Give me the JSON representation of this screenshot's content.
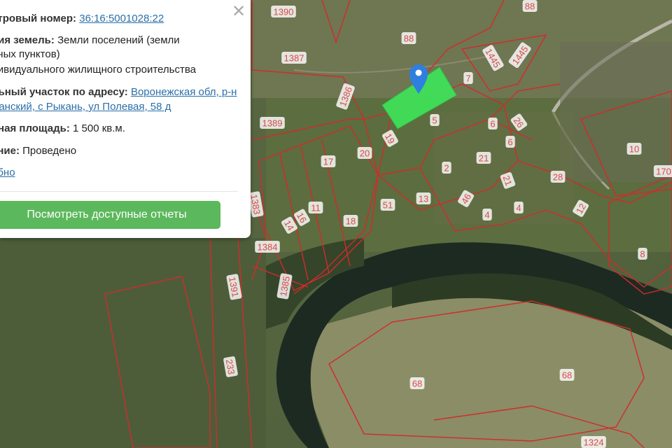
{
  "panel": {
    "cadastral_label": "стровый номер:",
    "cadastral_value": "36:16:5001028:22",
    "category_label": "рия земель:",
    "category_line1": "Земли поселений (земли",
    "category_line2": "нных пунктов)",
    "category_line3": "дивидуального жилищного строительства",
    "address_label": "льный участок по адресу:",
    "address_line1": "Воронежская обл, р-н",
    "address_line2": "манский, с Рыкань, ул Полевая, 58 д",
    "area_label": "нная площадь:",
    "area_value": "1 500 кв.м.",
    "survey_label": "ание:",
    "survey_value": "Проведено",
    "details_link": "обно",
    "report_button": "Посмотреть доступные отчеты"
  },
  "map": {
    "plot_labels": [
      "1390",
      "88",
      "88",
      "1387",
      "1445",
      "1445",
      "7",
      "1386",
      "5",
      "1389",
      "6",
      "26",
      "19",
      "17",
      "20",
      "2",
      "21",
      "6",
      "10",
      "170",
      "28",
      "21",
      "11",
      "16",
      "18",
      "51",
      "13",
      "46",
      "4",
      "4",
      "12",
      "8",
      "1384",
      "14",
      "1391",
      "1385",
      "233",
      "68",
      "68",
      "1324",
      "1383"
    ],
    "marker": "location-pin",
    "colors": {
      "boundary": "#d22b2b",
      "selected_plot": "#3ee65a",
      "marker": "#2f7fe0",
      "label": "#d94a4a"
    }
  }
}
